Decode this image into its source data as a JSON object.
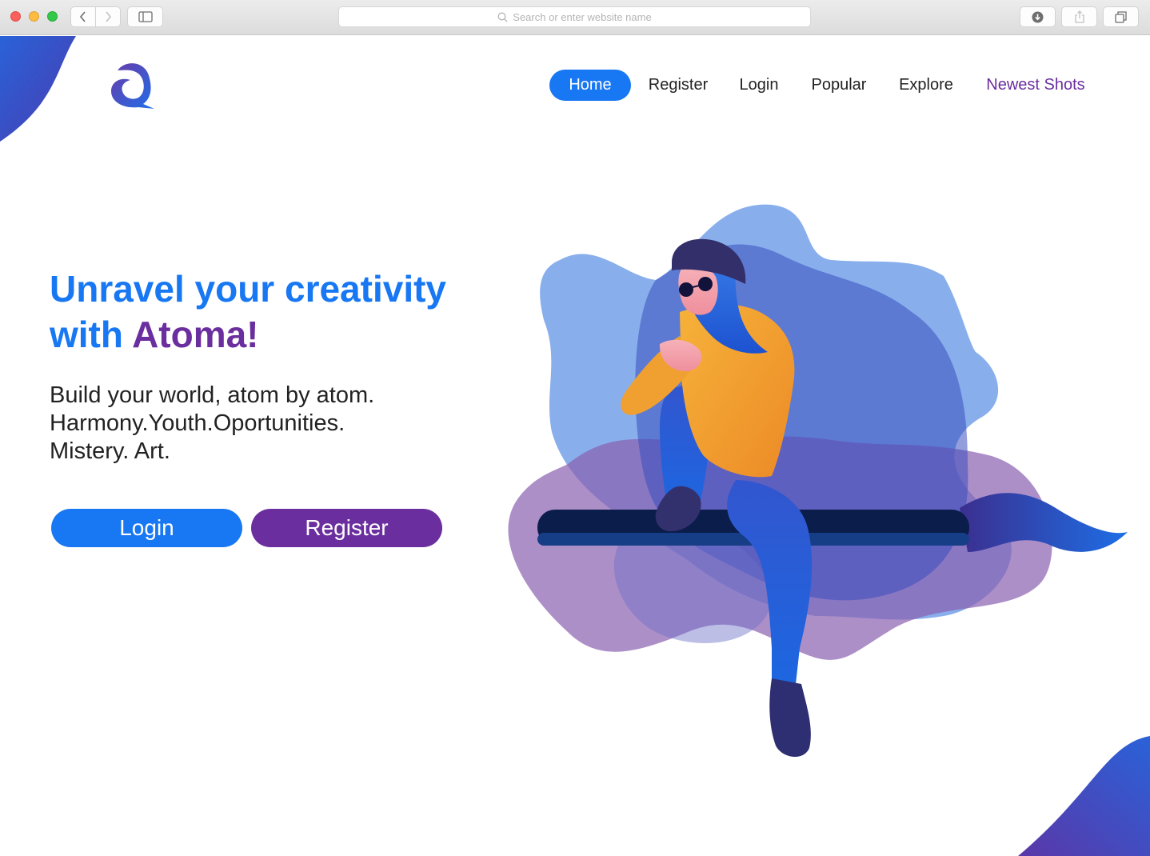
{
  "browser": {
    "address_placeholder": "Search or enter website name",
    "icons": {
      "back": "chevron-left-icon",
      "forward": "chevron-right-icon",
      "sidebar": "sidebar-icon",
      "search": "search-icon",
      "download": "download-icon",
      "share": "share-icon",
      "tabs": "tabs-icon"
    }
  },
  "header": {
    "logo": "atoma-logo",
    "nav": [
      {
        "label": "Home",
        "active": true
      },
      {
        "label": "Register",
        "active": false
      },
      {
        "label": "Login",
        "active": false
      },
      {
        "label": "Popular",
        "active": false
      },
      {
        "label": "Explore",
        "active": false
      },
      {
        "label": "Newest Shots",
        "active": false
      }
    ]
  },
  "hero": {
    "headline_line1": "Unravel your creativity",
    "headline_line2_prefix": "with ",
    "headline_brand": "Atoma!",
    "subtext_lines": [
      "Build your world, atom by atom.",
      "Harmony.Youth.Oportunities.",
      "Mistery. Art."
    ],
    "login_label": "Login",
    "register_label": "Register"
  },
  "colors": {
    "primary_blue": "#1877f2",
    "brand_purple": "#6a2e9e",
    "text_dark": "#222222"
  }
}
